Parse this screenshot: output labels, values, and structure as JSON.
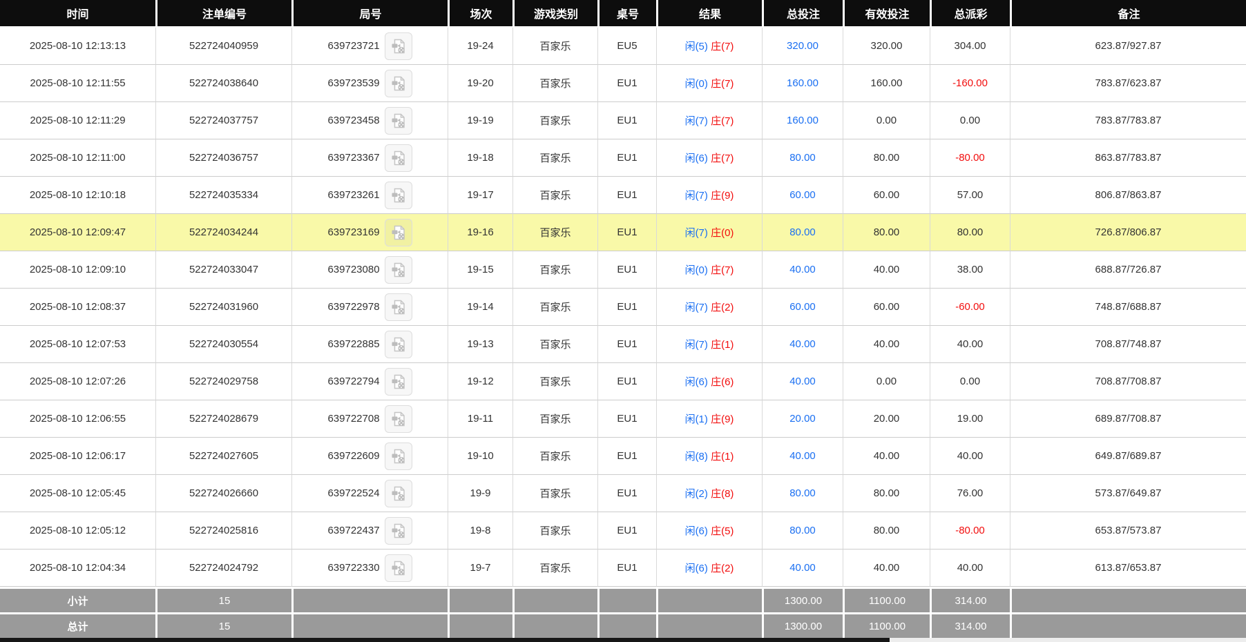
{
  "colors": {
    "header_bg": "#0d0d0d",
    "accent_blue": "#1a6ff2",
    "negative_red": "#f20d0d",
    "highlight_yellow": "#f9f9a8",
    "footer_gray": "#9a9a9a"
  },
  "icons": {
    "video_replay": "video-replay-icon"
  },
  "table": {
    "columns": [
      {
        "key": "time",
        "label": "时间"
      },
      {
        "key": "bet_id",
        "label": "注单编号"
      },
      {
        "key": "round_id",
        "label": "局号"
      },
      {
        "key": "session",
        "label": "场次"
      },
      {
        "key": "game_type",
        "label": "游戏类别"
      },
      {
        "key": "table_no",
        "label": "桌号"
      },
      {
        "key": "result",
        "label": "结果"
      },
      {
        "key": "total_bet",
        "label": "总投注"
      },
      {
        "key": "valid_bet",
        "label": "有效投注"
      },
      {
        "key": "payout",
        "label": "总派彩"
      },
      {
        "key": "remark",
        "label": "备注"
      }
    ],
    "rows": [
      {
        "time": "2025-08-10 12:13:13",
        "bet_id": "522724040959",
        "round_id": "639723721",
        "session": "19-24",
        "game_type": "百家乐",
        "table_no": "EU5",
        "result_player": "闲(5)",
        "result_banker": "庄(7)",
        "total_bet": "320.00",
        "valid_bet": "320.00",
        "payout": "304.00",
        "remark": "623.87/927.87",
        "highlighted": false
      },
      {
        "time": "2025-08-10 12:11:55",
        "bet_id": "522724038640",
        "round_id": "639723539",
        "session": "19-20",
        "game_type": "百家乐",
        "table_no": "EU1",
        "result_player": "闲(0)",
        "result_banker": "庄(7)",
        "total_bet": "160.00",
        "valid_bet": "160.00",
        "payout": "-160.00",
        "remark": "783.87/623.87",
        "highlighted": false
      },
      {
        "time": "2025-08-10 12:11:29",
        "bet_id": "522724037757",
        "round_id": "639723458",
        "session": "19-19",
        "game_type": "百家乐",
        "table_no": "EU1",
        "result_player": "闲(7)",
        "result_banker": "庄(7)",
        "total_bet": "160.00",
        "valid_bet": "0.00",
        "payout": "0.00",
        "remark": "783.87/783.87",
        "highlighted": false
      },
      {
        "time": "2025-08-10 12:11:00",
        "bet_id": "522724036757",
        "round_id": "639723367",
        "session": "19-18",
        "game_type": "百家乐",
        "table_no": "EU1",
        "result_player": "闲(6)",
        "result_banker": "庄(7)",
        "total_bet": "80.00",
        "valid_bet": "80.00",
        "payout": "-80.00",
        "remark": "863.87/783.87",
        "highlighted": false
      },
      {
        "time": "2025-08-10 12:10:18",
        "bet_id": "522724035334",
        "round_id": "639723261",
        "session": "19-17",
        "game_type": "百家乐",
        "table_no": "EU1",
        "result_player": "闲(7)",
        "result_banker": "庄(9)",
        "total_bet": "60.00",
        "valid_bet": "60.00",
        "payout": "57.00",
        "remark": "806.87/863.87",
        "highlighted": false
      },
      {
        "time": "2025-08-10 12:09:47",
        "bet_id": "522724034244",
        "round_id": "639723169",
        "session": "19-16",
        "game_type": "百家乐",
        "table_no": "EU1",
        "result_player": "闲(7)",
        "result_banker": "庄(0)",
        "total_bet": "80.00",
        "valid_bet": "80.00",
        "payout": "80.00",
        "remark": "726.87/806.87",
        "highlighted": true
      },
      {
        "time": "2025-08-10 12:09:10",
        "bet_id": "522724033047",
        "round_id": "639723080",
        "session": "19-15",
        "game_type": "百家乐",
        "table_no": "EU1",
        "result_player": "闲(0)",
        "result_banker": "庄(7)",
        "total_bet": "40.00",
        "valid_bet": "40.00",
        "payout": "38.00",
        "remark": "688.87/726.87",
        "highlighted": false
      },
      {
        "time": "2025-08-10 12:08:37",
        "bet_id": "522724031960",
        "round_id": "639722978",
        "session": "19-14",
        "game_type": "百家乐",
        "table_no": "EU1",
        "result_player": "闲(7)",
        "result_banker": "庄(2)",
        "total_bet": "60.00",
        "valid_bet": "60.00",
        "payout": "-60.00",
        "remark": "748.87/688.87",
        "highlighted": false
      },
      {
        "time": "2025-08-10 12:07:53",
        "bet_id": "522724030554",
        "round_id": "639722885",
        "session": "19-13",
        "game_type": "百家乐",
        "table_no": "EU1",
        "result_player": "闲(7)",
        "result_banker": "庄(1)",
        "total_bet": "40.00",
        "valid_bet": "40.00",
        "payout": "40.00",
        "remark": "708.87/748.87",
        "highlighted": false
      },
      {
        "time": "2025-08-10 12:07:26",
        "bet_id": "522724029758",
        "round_id": "639722794",
        "session": "19-12",
        "game_type": "百家乐",
        "table_no": "EU1",
        "result_player": "闲(6)",
        "result_banker": "庄(6)",
        "total_bet": "40.00",
        "valid_bet": "0.00",
        "payout": "0.00",
        "remark": "708.87/708.87",
        "highlighted": false
      },
      {
        "time": "2025-08-10 12:06:55",
        "bet_id": "522724028679",
        "round_id": "639722708",
        "session": "19-11",
        "game_type": "百家乐",
        "table_no": "EU1",
        "result_player": "闲(1)",
        "result_banker": "庄(9)",
        "total_bet": "20.00",
        "valid_bet": "20.00",
        "payout": "19.00",
        "remark": "689.87/708.87",
        "highlighted": false
      },
      {
        "time": "2025-08-10 12:06:17",
        "bet_id": "522724027605",
        "round_id": "639722609",
        "session": "19-10",
        "game_type": "百家乐",
        "table_no": "EU1",
        "result_player": "闲(8)",
        "result_banker": "庄(1)",
        "total_bet": "40.00",
        "valid_bet": "40.00",
        "payout": "40.00",
        "remark": "649.87/689.87",
        "highlighted": false
      },
      {
        "time": "2025-08-10 12:05:45",
        "bet_id": "522724026660",
        "round_id": "639722524",
        "session": "19-9",
        "game_type": "百家乐",
        "table_no": "EU1",
        "result_player": "闲(2)",
        "result_banker": "庄(8)",
        "total_bet": "80.00",
        "valid_bet": "80.00",
        "payout": "76.00",
        "remark": "573.87/649.87",
        "highlighted": false
      },
      {
        "time": "2025-08-10 12:05:12",
        "bet_id": "522724025816",
        "round_id": "639722437",
        "session": "19-8",
        "game_type": "百家乐",
        "table_no": "EU1",
        "result_player": "闲(6)",
        "result_banker": "庄(5)",
        "total_bet": "80.00",
        "valid_bet": "80.00",
        "payout": "-80.00",
        "remark": "653.87/573.87",
        "highlighted": false
      },
      {
        "time": "2025-08-10 12:04:34",
        "bet_id": "522724024792",
        "round_id": "639722330",
        "session": "19-7",
        "game_type": "百家乐",
        "table_no": "EU1",
        "result_player": "闲(6)",
        "result_banker": "庄(2)",
        "total_bet": "40.00",
        "valid_bet": "40.00",
        "payout": "40.00",
        "remark": "613.87/653.87",
        "highlighted": false
      }
    ],
    "footer": {
      "subtotal": {
        "label": "小计",
        "count": "15",
        "total_bet": "1300.00",
        "valid_bet": "1100.00",
        "payout": "314.00"
      },
      "total": {
        "label": "总计",
        "count": "15",
        "total_bet": "1300.00",
        "valid_bet": "1100.00",
        "payout": "314.00"
      }
    }
  }
}
